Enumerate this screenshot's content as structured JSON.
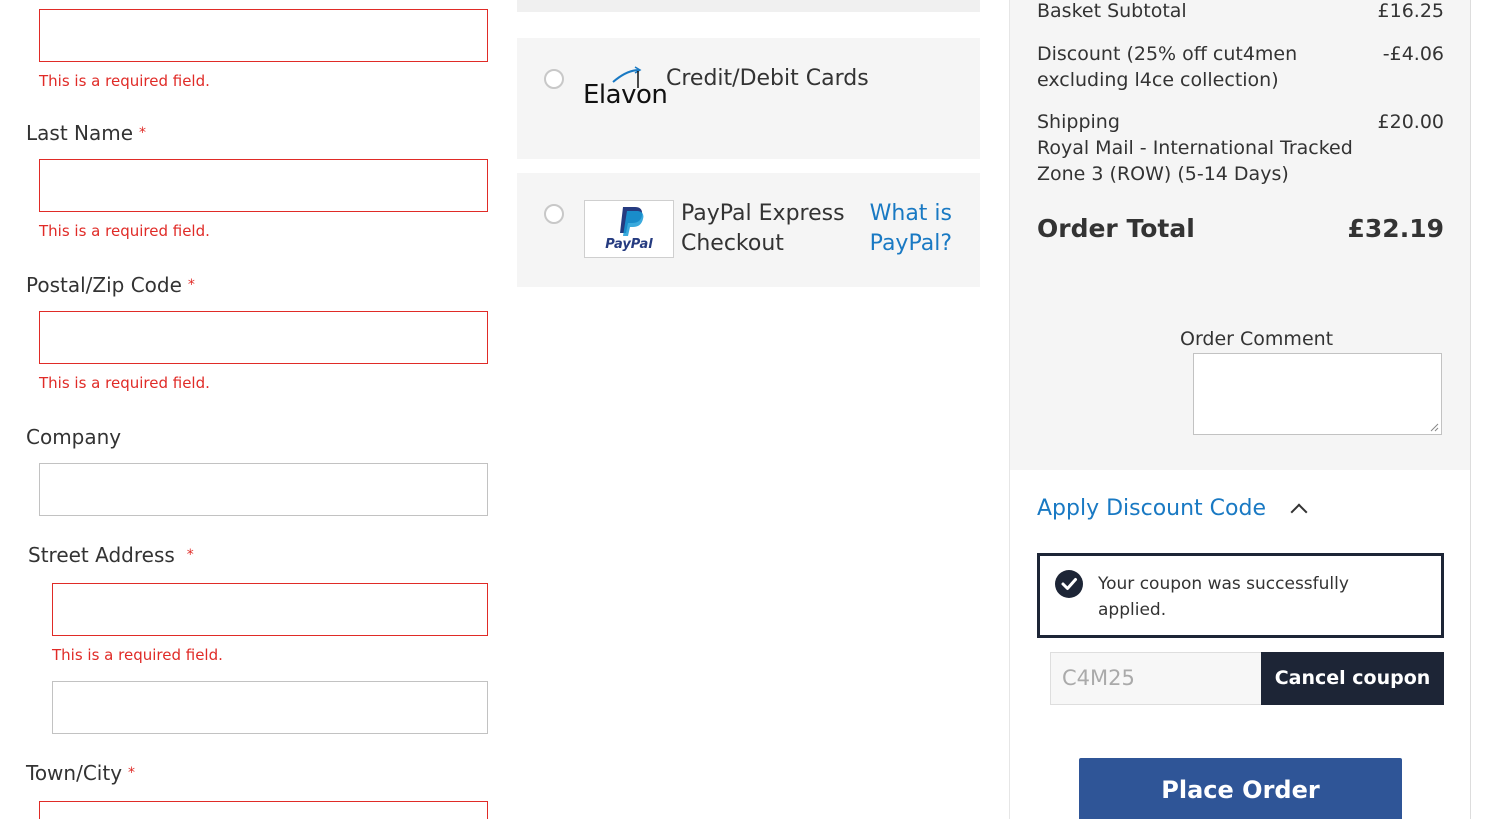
{
  "form": {
    "required_marker": "*",
    "error_required": "This is a required field.",
    "first_name": {
      "value": ""
    },
    "last_name": {
      "label": "Last Name",
      "value": ""
    },
    "postcode": {
      "label": "Postal/Zip Code",
      "value": ""
    },
    "company": {
      "label": "Company",
      "value": ""
    },
    "street": {
      "label": "Street Address",
      "line1": "",
      "line2": ""
    },
    "city": {
      "label": "Town/City",
      "value": ""
    }
  },
  "payment": {
    "methods": [
      {
        "id": "elavon",
        "logo_text": "Elavon",
        "label": "Credit/Debit Cards",
        "selected": false
      },
      {
        "id": "paypal",
        "logo_text": "PayPal",
        "label_line1": "PayPal Express",
        "label_line2": "Checkout",
        "link_line1": "What is",
        "link_line2": "PayPal?",
        "selected": false
      }
    ]
  },
  "summary": {
    "subtotal_label": "Basket Subtotal",
    "subtotal_value": "£16.25",
    "discount_label_line1": "Discount (25% off cut4men",
    "discount_label_line2": "excluding l4ce collection)",
    "discount_value": "-£4.06",
    "shipping_label": "Shipping",
    "shipping_method_line1": "Royal Mail - International Tracked",
    "shipping_method_line2": "Zone 3 (ROW) (5-14 Days)",
    "shipping_value": "£20.00",
    "order_total_label": "Order Total",
    "order_total_value": "£32.19",
    "comment_label": "Order Comment",
    "comment_value": ""
  },
  "discount": {
    "toggle_label": "Apply Discount Code",
    "expanded": true,
    "success_line1": "Your coupon was successfully",
    "success_line2": "applied.",
    "code": "C4M25",
    "cancel_label": "Cancel coupon"
  },
  "place_order_label": "Place Order",
  "colors": {
    "error": "#e02b27",
    "link": "#1979c3",
    "dark_button": "#1d2536",
    "primary_button": "#2f5597",
    "panel_bg": "#f5f5f5"
  }
}
